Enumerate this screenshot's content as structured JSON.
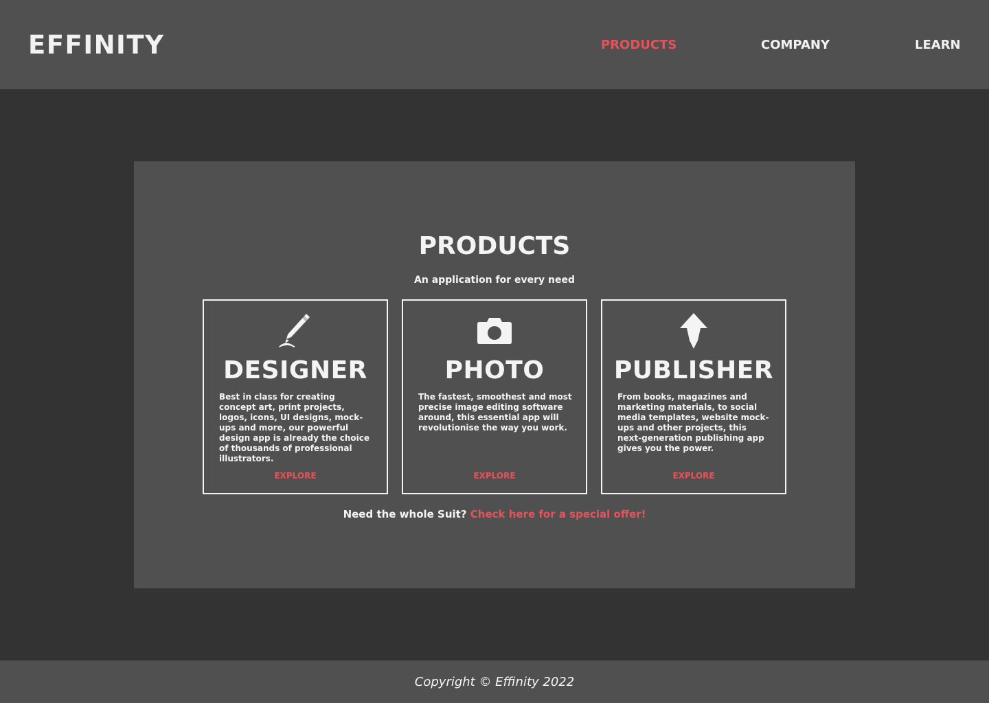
{
  "header": {
    "logo": "EFFINITY",
    "nav": [
      {
        "label": "PRODUCTS",
        "active": true
      },
      {
        "label": "COMPANY",
        "active": false
      },
      {
        "label": "LEARN",
        "active": false
      }
    ]
  },
  "products": {
    "title": "PRODUCTS",
    "subtitle": "An application for every need",
    "cards": [
      {
        "icon": "pen-icon",
        "title": "DESIGNER",
        "description": "Best in class for creating concept art, print projects, logos, icons, UI designs, mock-ups and more, our powerful design app is already the choice of thousands of professional illustrators.",
        "link": "EXPLORE"
      },
      {
        "icon": "camera-icon",
        "title": "PHOTO",
        "description": "The fastest, smoothest and most precise image editing software around, this essential app will revolutionise the way you work.",
        "link": "EXPLORE"
      },
      {
        "icon": "pen-nib-icon",
        "title": "PUBLISHER",
        "description": "From books, magazines and marketing materials, to social media templates, website mock-ups and other projects, this next-generation publishing app gives you the power.",
        "link": "EXPLORE"
      }
    ],
    "offer_text": "Need the whole Suit?",
    "offer_link": "Check here for a special offer!"
  },
  "footer": {
    "copyright": "Copyright © Effinity 2022"
  },
  "colors": {
    "header_bg": "#505050",
    "page_bg": "#333333",
    "panel_bg": "#505050",
    "accent": "#e5535a",
    "text": "#f4f4f4"
  }
}
